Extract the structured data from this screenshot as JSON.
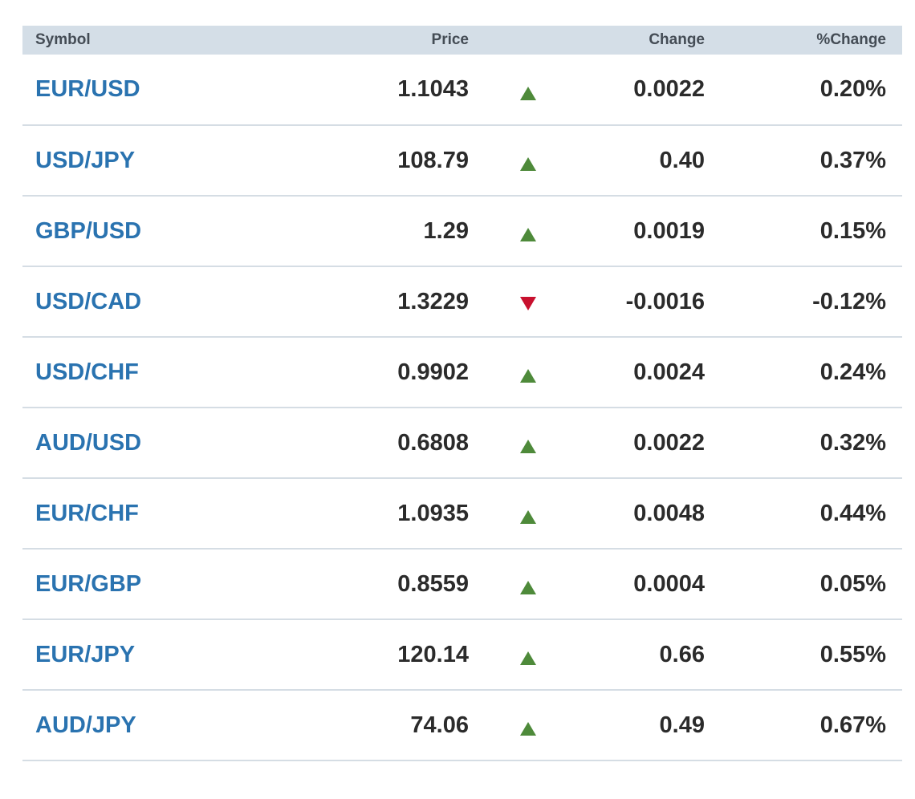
{
  "table": {
    "headers": {
      "symbol": "Symbol",
      "price": "Price",
      "change": "Change",
      "pct_change": "%Change"
    },
    "colors": {
      "up": "#4e8a3a",
      "down": "#c8102e",
      "symbol_link": "#2a73b0",
      "header_bg": "#d4dee7"
    },
    "rows": [
      {
        "symbol": "EUR/USD",
        "price": "1.1043",
        "direction": "up",
        "change": "0.0022",
        "pct_change": "0.20%"
      },
      {
        "symbol": "USD/JPY",
        "price": "108.79",
        "direction": "up",
        "change": "0.40",
        "pct_change": "0.37%"
      },
      {
        "symbol": "GBP/USD",
        "price": "1.29",
        "direction": "up",
        "change": "0.0019",
        "pct_change": "0.15%"
      },
      {
        "symbol": "USD/CAD",
        "price": "1.3229",
        "direction": "down",
        "change": "-0.0016",
        "pct_change": "-0.12%"
      },
      {
        "symbol": "USD/CHF",
        "price": "0.9902",
        "direction": "up",
        "change": "0.0024",
        "pct_change": "0.24%"
      },
      {
        "symbol": "AUD/USD",
        "price": "0.6808",
        "direction": "up",
        "change": "0.0022",
        "pct_change": "0.32%"
      },
      {
        "symbol": "EUR/CHF",
        "price": "1.0935",
        "direction": "up",
        "change": "0.0048",
        "pct_change": "0.44%"
      },
      {
        "symbol": "EUR/GBP",
        "price": "0.8559",
        "direction": "up",
        "change": "0.0004",
        "pct_change": "0.05%"
      },
      {
        "symbol": "EUR/JPY",
        "price": "120.14",
        "direction": "up",
        "change": "0.66",
        "pct_change": "0.55%"
      },
      {
        "symbol": "AUD/JPY",
        "price": "74.06",
        "direction": "up",
        "change": "0.49",
        "pct_change": "0.67%"
      }
    ]
  }
}
